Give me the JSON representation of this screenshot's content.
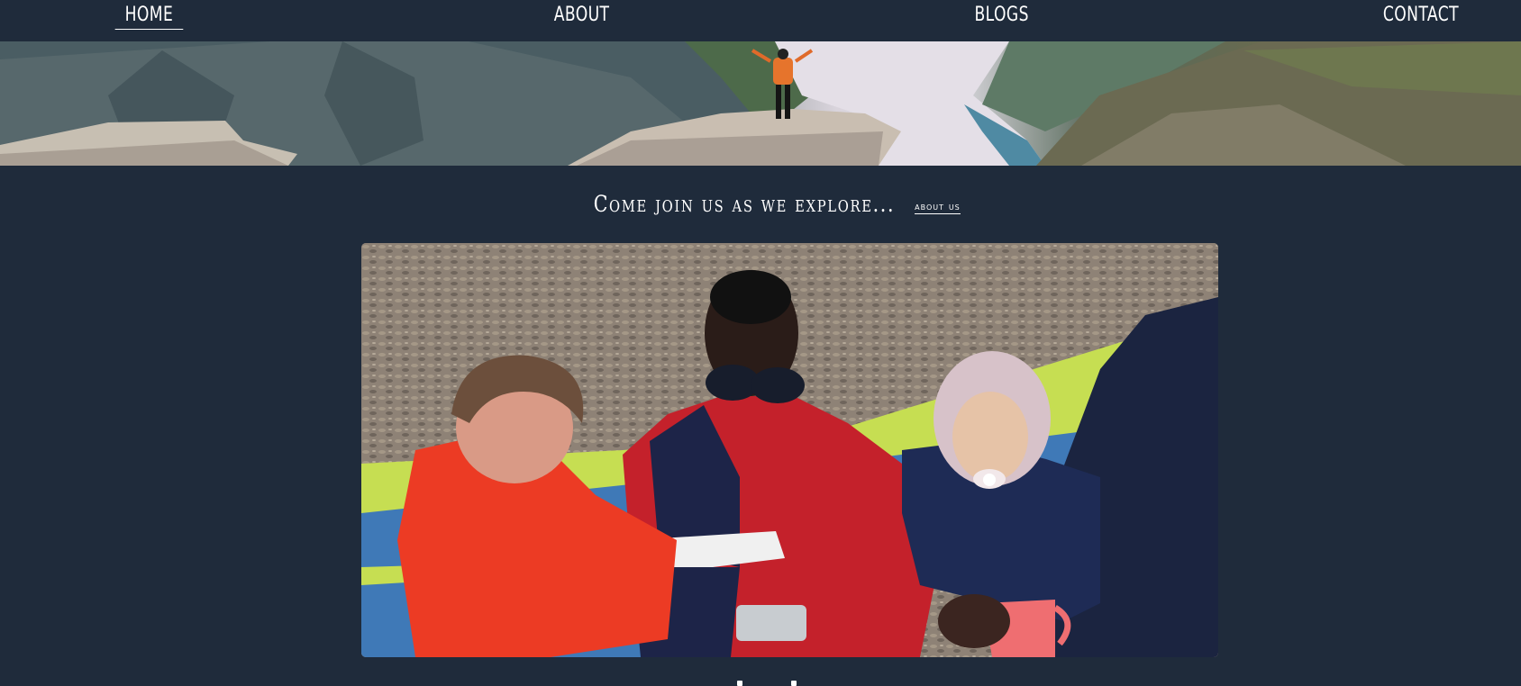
{
  "nav": {
    "items": [
      {
        "label": "HOME",
        "active": true
      },
      {
        "label": "ABOUT",
        "active": false
      },
      {
        "label": "BLOGS",
        "active": false
      },
      {
        "label": "CONTACT",
        "active": false
      }
    ]
  },
  "hero": {
    "image": "mountain-fjord-banner"
  },
  "intro": {
    "tagline": "Come join us as we explore...",
    "link_label": "about us"
  },
  "featured": {
    "image": "family-in-hammock-photo"
  },
  "colors": {
    "background": "#1f2b3b",
    "text": "#ffffff"
  }
}
